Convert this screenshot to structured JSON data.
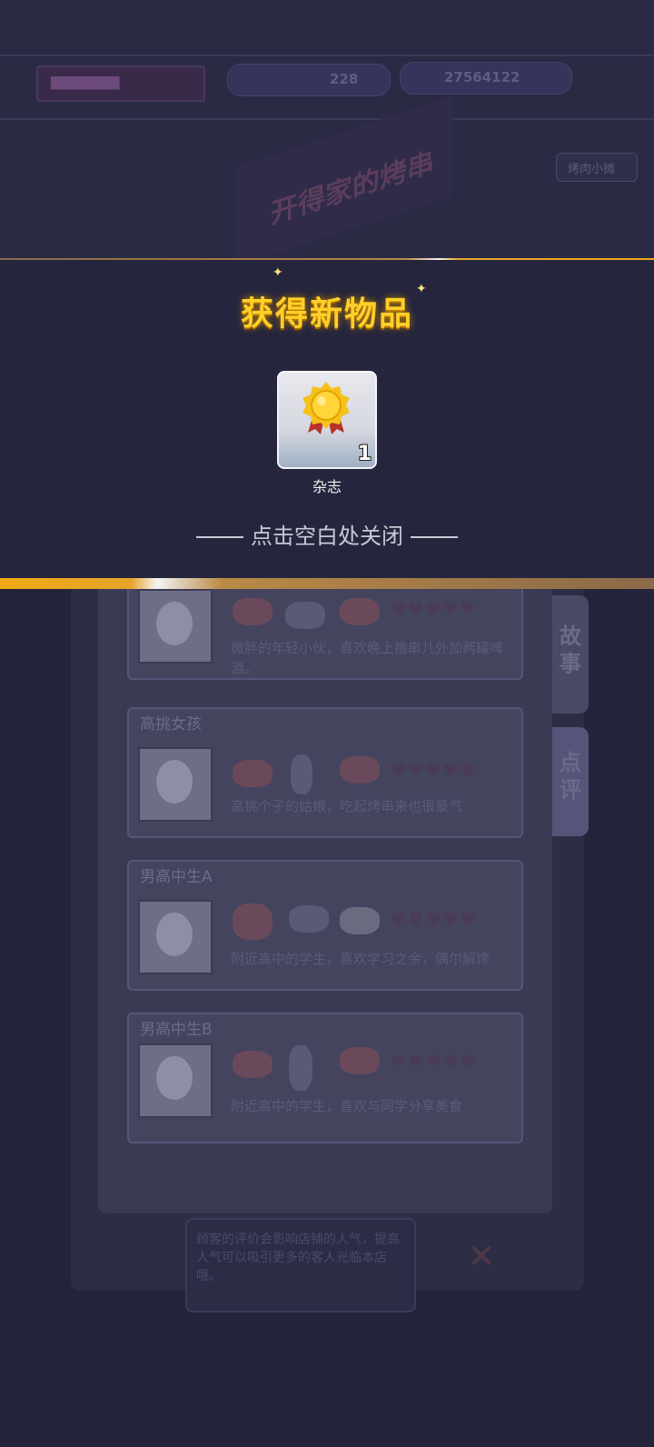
{
  "background": {
    "counters": [
      "228",
      "27564122"
    ],
    "shop_sign": "开得家的烤串",
    "side_tab_label": "烤肉小摊",
    "tabs": [
      "故事",
      "点评"
    ],
    "customers": [
      {
        "name": "",
        "description": "微胖的年轻小伙，喜欢晚上撸串儿外加两罐啤酒。",
        "hearts": "♥♥♥♥♥"
      },
      {
        "name": "高挑女孩",
        "description": "高挑个子的姑娘，吃起烤串来也很豪气",
        "hearts": "♥♥♥♥♥"
      },
      {
        "name": "男高中生A",
        "description": "附近高中的学生，喜欢学习之余，偶尔解馋",
        "hearts": "♥♥♥♥♥"
      },
      {
        "name": "男高中生B",
        "description": "附近高中的学生，喜欢与同学分享美食",
        "hearts": "♥♥♥♥♥"
      }
    ],
    "bottom_tip": "顾客的评价会影响店铺的人气，提高人气可以吸引更多的客人光临本店哦。"
  },
  "popup": {
    "title": "获得新物品",
    "item": {
      "name": "杂志",
      "count": "1",
      "icon": "gold-medal-icon"
    },
    "hint": "点击空白处关闭"
  },
  "colors": {
    "title": "#ffcf2a",
    "band": "#f0a914",
    "overlay": "#25253d"
  }
}
